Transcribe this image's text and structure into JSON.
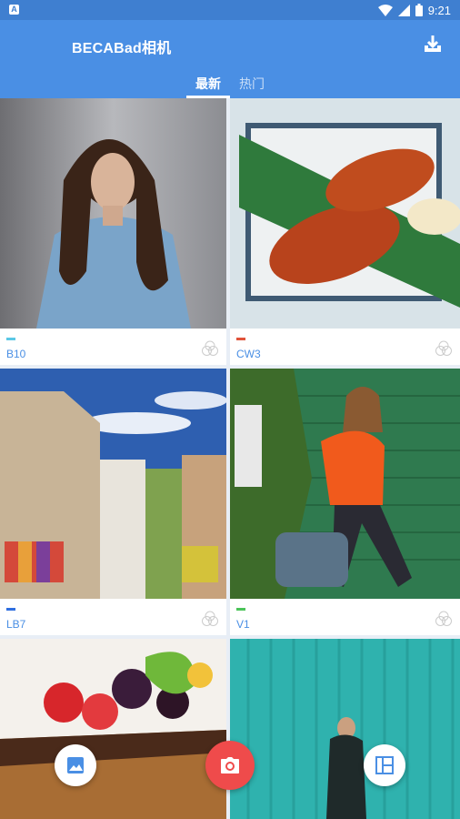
{
  "status": {
    "time": "9:21",
    "app_icon": "A"
  },
  "header": {
    "title": "BECABad相机",
    "download_icon": "download-icon"
  },
  "tabs": [
    {
      "label": "最新",
      "active": true
    },
    {
      "label": "热门",
      "active": false
    }
  ],
  "filters": [
    {
      "name": "B10",
      "accent": "#5bc8e6"
    },
    {
      "name": "CW3",
      "accent": "#e0533a"
    },
    {
      "name": "LB7",
      "accent": "#2f6fe0"
    },
    {
      "name": "V1",
      "accent": "#4cc45a"
    }
  ],
  "fabs": {
    "gallery_icon": "gallery-icon",
    "camera_icon": "camera-icon",
    "layout_icon": "layout-icon"
  },
  "colors": {
    "primary": "#4a8fe4",
    "camera": "#ef4b4b"
  }
}
